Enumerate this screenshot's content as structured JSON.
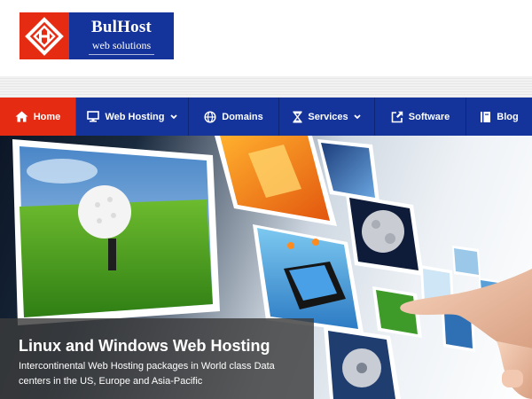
{
  "logo": {
    "brand": "BulHost",
    "tagline": "web solutions",
    "colors": {
      "mark": "#e52b12",
      "text_panel": "#15349b"
    }
  },
  "nav": {
    "items": [
      {
        "label": "Home",
        "icon": "home-icon",
        "active": true,
        "has_dropdown": false
      },
      {
        "label": "Web Hosting",
        "icon": "monitor-icon",
        "active": false,
        "has_dropdown": true
      },
      {
        "label": "Domains",
        "icon": "globe-icon",
        "active": false,
        "has_dropdown": false
      },
      {
        "label": "Services",
        "icon": "hourglass-icon",
        "active": false,
        "has_dropdown": true
      },
      {
        "label": "Software",
        "icon": "external-link-icon",
        "active": false,
        "has_dropdown": false
      },
      {
        "label": "Blog",
        "icon": "book-icon",
        "active": false,
        "has_dropdown": false
      }
    ],
    "colors": {
      "bar": "#15349b",
      "active": "#e52b12"
    }
  },
  "banner": {
    "title": "Linux and Windows Web Hosting",
    "description": "Intercontinental Web Hosting packages in World class Data centers in the US, Europe and Asia-Pacific"
  }
}
